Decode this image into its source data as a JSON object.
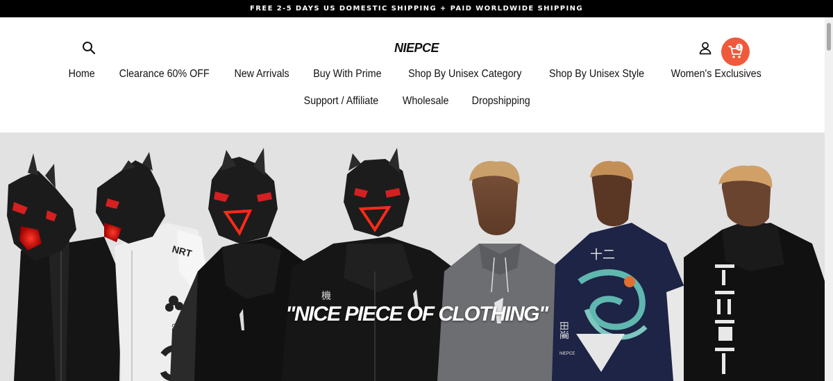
{
  "announcement": "FREE 2-5 DAYS US DOMESTIC SHIPPING + PAID WORLDWIDE SHIPPING",
  "header": {
    "logo": "NIEPCE",
    "cart_count": "1"
  },
  "nav": {
    "row1": [
      "Home",
      "Clearance 60% OFF",
      "New Arrivals",
      "Buy With Prime",
      "Shop By Unisex Category",
      "Shop By Unisex Style",
      "Women's Exclusives"
    ],
    "row2": [
      "Support / Affiliate",
      "Wholesale",
      "Dropshipping"
    ]
  },
  "hero": {
    "caption": "\"NICE PIECE OF CLOTHING\"",
    "garment_texts": {
      "nrt": "NRT",
      "ueg": "UEG",
      "kanji_machine": "機",
      "kanji_mark": "十二",
      "brand_tag": "NIEPCE",
      "kanji_back": "田運"
    }
  },
  "colors": {
    "accent": "#f05a3c",
    "announce_bg": "#000000",
    "hero_bg": "#e2e2e2"
  },
  "icons": {
    "search": "search-icon",
    "account": "account-icon",
    "cart": "cart-icon"
  }
}
